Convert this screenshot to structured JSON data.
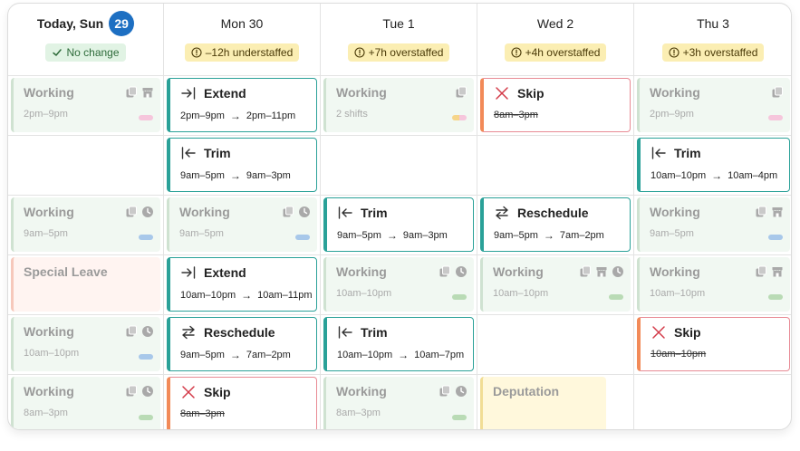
{
  "colors": {
    "accent": "#1d6fc2",
    "action": "#2aa198",
    "skip_border": "#e88a94",
    "working_bg": "#f1f8f2",
    "warn_bg": "#fbeeb3",
    "ok_bg": "#e1f3e4",
    "tag_pink": "#f6c6dc",
    "tag_blue": "#a8c8ea",
    "tag_green": "#b9dbb5",
    "tag_mixed": "#f6d58a"
  },
  "days": [
    {
      "label": "Today, Sun",
      "badge": "29",
      "status": "No change",
      "status_type": "ok"
    },
    {
      "label": "Mon 30",
      "status": "–12h understaffed",
      "status_type": "warn"
    },
    {
      "label": "Tue 1",
      "status": "+7h overstaffed",
      "status_type": "warn"
    },
    {
      "label": "Wed 2",
      "status": "+4h overstaffed",
      "status_type": "warn"
    },
    {
      "label": "Thu 3",
      "status": "+3h overstaffed",
      "status_type": "warn"
    }
  ],
  "rows": [
    [
      {
        "type": "work",
        "title": "Working",
        "time": "2pm–9pm",
        "icons": [
          "copy-icon",
          "store-icon"
        ],
        "tag": "pink"
      },
      {
        "type": "action",
        "icon": "extend-icon",
        "title": "Extend",
        "from": "2pm–9pm",
        "to": "2pm–11pm"
      },
      {
        "type": "work",
        "title": "Working",
        "time": "2 shifts",
        "icons": [
          "copy-icon"
        ],
        "tag": "mixed"
      },
      {
        "type": "skip",
        "title": "Skip",
        "time": "8am–3pm"
      },
      {
        "type": "work",
        "title": "Working",
        "time": "2pm–9pm",
        "icons": [
          "copy-icon"
        ],
        "tag": "pink"
      }
    ],
    [
      {
        "type": "empty"
      },
      {
        "type": "action",
        "icon": "trim-icon",
        "title": "Trim",
        "from": "9am–5pm",
        "to": "9am–3pm"
      },
      {
        "type": "empty"
      },
      {
        "type": "empty"
      },
      {
        "type": "action",
        "icon": "trim-icon",
        "title": "Trim",
        "from": "10am–10pm",
        "to": "10am–4pm"
      }
    ],
    [
      {
        "type": "work",
        "title": "Working",
        "time": "9am–5pm",
        "icons": [
          "copy-icon",
          "clock-icon"
        ],
        "tag": "blue"
      },
      {
        "type": "work",
        "title": "Working",
        "time": "9am–5pm",
        "icons": [
          "copy-icon",
          "clock-icon"
        ],
        "tag": "blue"
      },
      {
        "type": "action",
        "icon": "trim-icon",
        "title": "Trim",
        "from": "9am–5pm",
        "to": "9am–3pm"
      },
      {
        "type": "action",
        "icon": "reschedule-icon",
        "title": "Reschedule",
        "from": "9am–5pm",
        "to": "7am–2pm"
      },
      {
        "type": "work",
        "title": "Working",
        "time": "9am–5pm",
        "icons": [
          "copy-icon",
          "store-icon"
        ],
        "tag": "blue"
      }
    ],
    [
      {
        "type": "leave",
        "title": "Special Leave"
      },
      {
        "type": "action",
        "icon": "extend-icon",
        "title": "Extend",
        "from": "10am–10pm",
        "to": "10am–11pm"
      },
      {
        "type": "work",
        "title": "Working",
        "time": "10am–10pm",
        "icons": [
          "copy-icon",
          "clock-icon"
        ],
        "tag": "green"
      },
      {
        "type": "work",
        "title": "Working",
        "time": "10am–10pm",
        "icons": [
          "copy-icon",
          "store-icon",
          "clock-icon"
        ],
        "tag": "green"
      },
      {
        "type": "work",
        "title": "Working",
        "time": "10am–10pm",
        "icons": [
          "copy-icon",
          "store-icon"
        ],
        "tag": "green"
      }
    ],
    [
      {
        "type": "work",
        "title": "Working",
        "time": "10am–10pm",
        "icons": [
          "copy-icon",
          "clock-icon"
        ],
        "tag": "blue"
      },
      {
        "type": "action",
        "icon": "reschedule-icon",
        "title": "Reschedule",
        "from": "9am–5pm",
        "to": "7am–2pm"
      },
      {
        "type": "action",
        "icon": "trim-icon",
        "title": "Trim",
        "from": "10am–10pm",
        "to": "10am–7pm"
      },
      {
        "type": "empty"
      },
      {
        "type": "skip",
        "title": "Skip",
        "time": "10am–10pm"
      }
    ],
    [
      {
        "type": "work",
        "title": "Working",
        "time": "8am–3pm",
        "icons": [
          "copy-icon",
          "clock-icon"
        ],
        "tag": "green"
      },
      {
        "type": "skip",
        "title": "Skip",
        "time": "8am–3pm"
      },
      {
        "type": "work",
        "title": "Working",
        "time": "8am–3pm",
        "icons": [
          "copy-icon",
          "clock-icon"
        ],
        "tag": "green"
      },
      {
        "type": "deput",
        "title": "Deputation"
      },
      {
        "type": "empty"
      }
    ]
  ]
}
